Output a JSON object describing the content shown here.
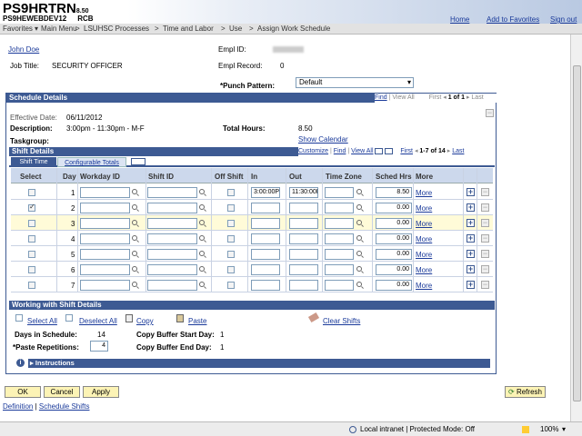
{
  "banner": {
    "title": "PS9HRTRN",
    "version": "8.50",
    "db": "PS9HEWEBDEV12",
    "user": "RCB",
    "links": [
      "Home",
      "Add to Favorites",
      "Sign out"
    ]
  },
  "nav": {
    "items": [
      "Favorites",
      "Main Menu",
      "LSUHSC Processes",
      "Time and Labor",
      "Use",
      "Assign Work Schedule"
    ]
  },
  "employee": {
    "name": "John Doe",
    "job_title_label": "Job Title:",
    "job_title": "SECURITY OFFICER",
    "empl_id_label": "Empl ID:",
    "empl_record_label": "Empl Record:",
    "empl_record": "0",
    "punch_label": "*Punch Pattern:",
    "punch_value": "Default"
  },
  "schedule": {
    "header": "Schedule Details",
    "nav": {
      "find": "Find",
      "view_all": "View All",
      "first": "First",
      "count": "1 of 1",
      "last": "Last"
    },
    "eff_label": "Effective Date:",
    "eff_value": "06/11/2012",
    "desc_label": "Description:",
    "desc_value": "3:00pm - 11:30pm - M-F",
    "hours_label": "Total Hours:",
    "hours_value": "8.50",
    "taskgroup_label": "Taskgroup:",
    "show_calendar": "Show Calendar"
  },
  "shift": {
    "header": "Shift Details",
    "nav": {
      "customize": "Customize",
      "find": "Find",
      "view_all": "View All",
      "first": "First",
      "count": "1-7 of 14",
      "last": "Last"
    },
    "tabs": [
      "Shift Time",
      "Configurable Totals"
    ],
    "columns": [
      "Select",
      "Day",
      "Workday ID",
      "Shift ID",
      "Off Shift",
      "In",
      "Out",
      "Time Zone",
      "Sched Hrs",
      "More"
    ],
    "rows": [
      {
        "day": "1",
        "in": "3:00:00PM",
        "out": "11:30:00PM",
        "hrs": "8.50",
        "more": "More",
        "checked": false
      },
      {
        "day": "2",
        "in": "",
        "out": "",
        "hrs": "0.00",
        "more": "More",
        "checked": true
      },
      {
        "day": "3",
        "in": "",
        "out": "",
        "hrs": "0.00",
        "more": "More",
        "checked": false
      },
      {
        "day": "4",
        "in": "",
        "out": "",
        "hrs": "0.00",
        "more": "More",
        "checked": false
      },
      {
        "day": "5",
        "in": "",
        "out": "",
        "hrs": "0.00",
        "more": "More",
        "checked": false
      },
      {
        "day": "6",
        "in": "",
        "out": "",
        "hrs": "0.00",
        "more": "More",
        "checked": false
      },
      {
        "day": "7",
        "in": "",
        "out": "",
        "hrs": "0.00",
        "more": "More",
        "checked": false
      }
    ]
  },
  "working": {
    "header": "Working with Shift Details",
    "select_all": "Select All",
    "deselect_all": "Deselect All",
    "copy": "Copy",
    "paste": "Paste",
    "clear": "Clear Shifts",
    "days_label": "Days in Schedule:",
    "days_value": "14",
    "paste_label": "*Paste Repetitions:",
    "paste_value": "4",
    "buf_start_label": "Copy Buffer Start Day:",
    "buf_start": "1",
    "buf_end_label": "Copy Buffer End Day:",
    "buf_end": "1",
    "instructions": "Instructions"
  },
  "buttons": {
    "ok": "OK",
    "cancel": "Cancel",
    "apply": "Apply",
    "refresh": "Refresh"
  },
  "bottom_links": [
    "Definition",
    "Schedule Shifts"
  ],
  "status": {
    "zone": "Local intranet | Protected Mode: Off",
    "zoom": "100%"
  },
  "colors": {
    "header_blue": "#3d5a93",
    "row_highlight": "#fffbd8",
    "button_yellow": "#fcf3b5"
  }
}
